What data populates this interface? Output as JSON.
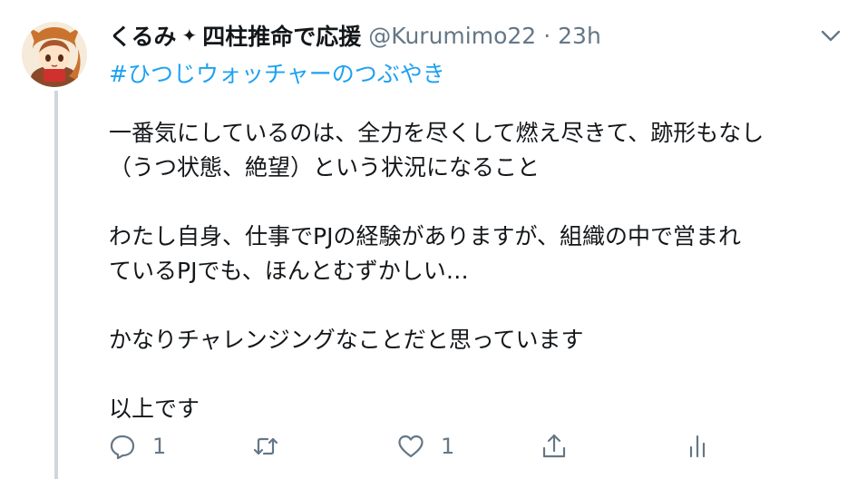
{
  "tweet": {
    "display_name": "くるみ",
    "name_suffix": "四柱推命で応援",
    "star_glyph": "✦",
    "handle": "@Kurumimo22",
    "separator": "·",
    "time": "23h",
    "hashtag": "#ひつじウォッチャーのつぶやき",
    "paragraphs": [
      [
        "一番気にしているのは、全力を尽くして燃え尽きて、跡形もなし",
        "（うつ状態、絶望）という状況になること"
      ],
      [
        "わたし自身、仕事でPJの経験がありますが、組織の中で営まれ",
        "ているPJでも、ほんとむずかしい…"
      ],
      [
        "かなりチャレンジングなことだと思っています"
      ],
      [
        "以上です"
      ]
    ]
  },
  "actions": {
    "reply_count": "1",
    "retweet_count": "",
    "like_count": "1"
  },
  "icons": {
    "reply": "reply-icon",
    "retweet": "retweet-icon",
    "like": "heart-icon",
    "share": "share-icon",
    "analytics": "analytics-icon",
    "caret": "chevron-down-icon"
  },
  "colors": {
    "text": "#14171a",
    "muted": "#657786",
    "link": "#1da1f2",
    "thread_line": "#cfd6dc"
  }
}
